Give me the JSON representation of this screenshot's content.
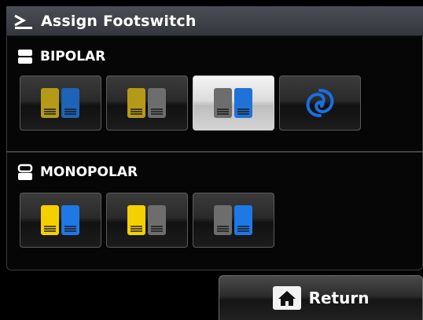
{
  "header": {
    "title": "Assign Footswitch",
    "icon": "footswitch-icon"
  },
  "bipolar": {
    "label": "BIPOLAR",
    "icon": "bipolar-mode-icon",
    "options": [
      {
        "name": "yellow-blue",
        "left": "#b49a18",
        "right": "#1d63b8",
        "selected": false
      },
      {
        "name": "yellow-gray",
        "left": "#b49a18",
        "right": "#6d6d6d",
        "selected": false
      },
      {
        "name": "gray-blue",
        "left": "#6d6d6d",
        "right": "#1f72d6",
        "selected": true
      },
      {
        "name": "swirl",
        "icon": "swirl-icon",
        "selected": false
      }
    ]
  },
  "monopolar": {
    "label": "MONOPOLAR",
    "icon": "monopolar-mode-icon",
    "options": [
      {
        "name": "yellow-blue",
        "left": "#f5d000",
        "right": "#1e78e6",
        "selected": false
      },
      {
        "name": "yellow-gray",
        "left": "#f5d000",
        "right": "#6d6d6d",
        "selected": false
      },
      {
        "name": "gray-blue",
        "left": "#6d6d6d",
        "right": "#1e78e6",
        "selected": false
      }
    ]
  },
  "footer": {
    "return_label": "Return",
    "return_icon": "home-icon"
  }
}
